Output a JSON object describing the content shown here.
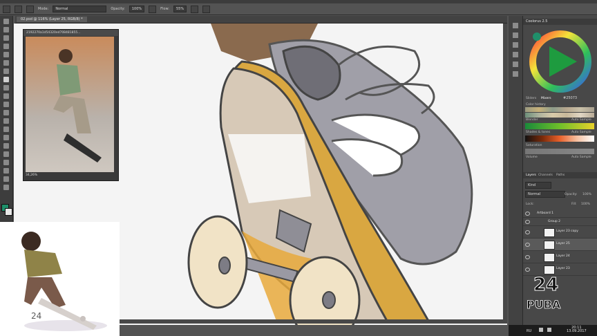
{
  "options_bar": {
    "mode_label": "Mode:",
    "mode_value": "Normal",
    "opacity_label": "Opacity:",
    "opacity_value": "100%",
    "flow_label": "Flow:",
    "flow_value": "55%"
  },
  "document": {
    "tab_label": "02.psd @ 116% (Layer 25, RGB/8) *"
  },
  "reference_window": {
    "title": "2192270a1d54320ed708481855...",
    "zoom": "34,26%"
  },
  "panels": {
    "coolorus_title": "Coolorus 2.5",
    "color_value": "#25073",
    "sliders_tab": "Sliders",
    "mixers_tab": "Mixers",
    "color_history_label": "Color history",
    "gradient1_label": "Blender",
    "gradient1_auto": "Auto Sample",
    "gradient2_label": "Shades & tones",
    "gradient2_auto": "Auto Sample",
    "saturation_label": "Saturation",
    "volume_label": "Volume",
    "volume_auto": "Auto Sample",
    "layers_tab": "Layers",
    "channels_tab": "Channels",
    "paths_tab": "Paths",
    "kind_label": "Kind",
    "blend_mode": "Normal",
    "opacity_label": "Opacity:",
    "opacity_value": "100%",
    "lock_label": "Lock:",
    "fill_label": "Fill:",
    "fill_value": "100%",
    "layers": [
      {
        "name": "Artboard 1"
      },
      {
        "name": "Group 2"
      },
      {
        "name": "Layer 23 copy"
      },
      {
        "name": "Layer 25"
      },
      {
        "name": "Layer 24"
      },
      {
        "name": "Layer 23"
      }
    ]
  },
  "taskbar": {
    "lang": "RU",
    "time": "20:11",
    "date": "13.09.2017"
  },
  "watermark": {
    "text": "24 PUBA"
  },
  "colors": {
    "ui_dark": "#3c3c3c",
    "ui_mid": "#535353",
    "deck_wood": "#d9a741",
    "wheel": "#f1e3c6",
    "shoe_grey": "#9a99a3"
  }
}
